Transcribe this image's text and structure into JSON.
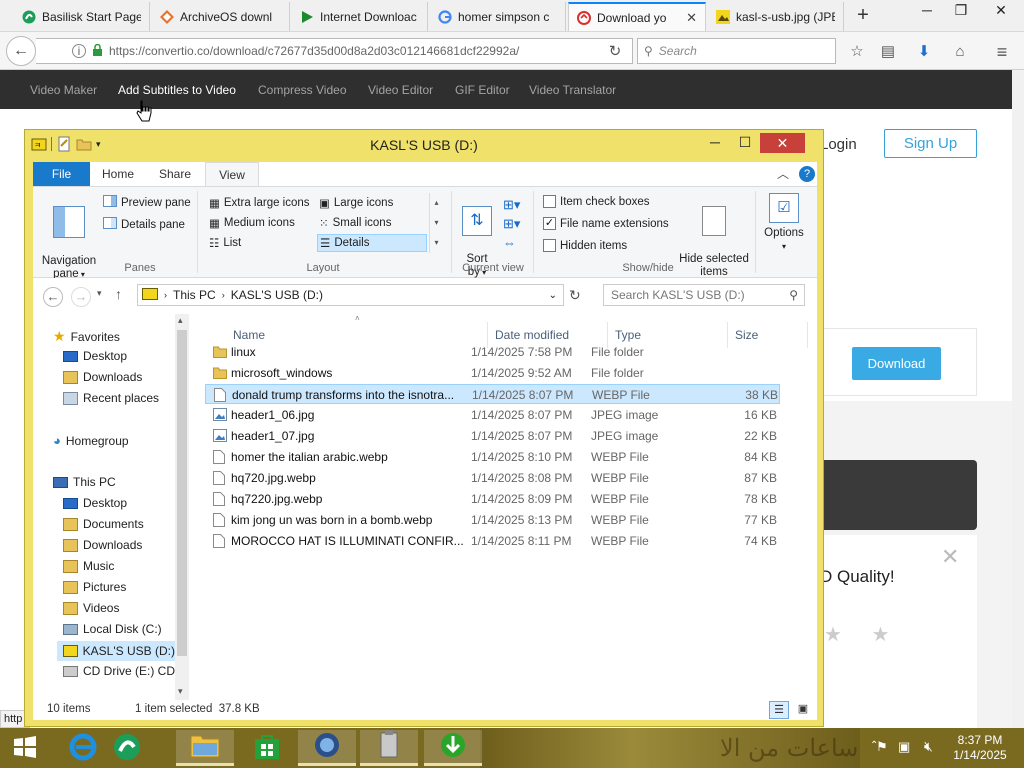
{
  "browser": {
    "tabs": [
      {
        "title": "Basilisk Start Page",
        "icon": "basilisk-icon"
      },
      {
        "title": "ArchiveOS downl",
        "icon": "archiveos-icon"
      },
      {
        "title": "Internet Downloac",
        "icon": "play-icon"
      },
      {
        "title": "homer simpson c",
        "icon": "google-icon"
      },
      {
        "title": "Download yo",
        "icon": "convertio-icon",
        "active": true
      },
      {
        "title": "kasl-s-usb.jpg (JPE",
        "icon": "image-icon"
      }
    ],
    "url": "https://convertio.co/download/c72677d35d00d8a2d03c012146681dcf22992a/",
    "search_placeholder": "Search"
  },
  "site": {
    "nav": [
      "Video Maker",
      "Add Subtitles to Video",
      "Compress Video",
      "Video Editor",
      "GIF Editor",
      "Video Translator"
    ],
    "nav_hovered": "Add Subtitles to Video",
    "login": "Login",
    "signup": "Sign Up",
    "download": "Download",
    "promo_text": "D Quality!",
    "promo_stars": "★ ★",
    "status_url": "http"
  },
  "explorer": {
    "title": "KASL'S USB (D:)",
    "ribbon_tabs": {
      "file": "File",
      "home": "Home",
      "share": "Share",
      "view": "View"
    },
    "ribbon": {
      "navigation_pane": "Navigation\npane",
      "preview_pane": "Preview pane",
      "details_pane": "Details pane",
      "panes_label": "Panes",
      "extra_large_icons": "Extra large icons",
      "large_icons": "Large icons",
      "medium_icons": "Medium icons",
      "small_icons": "Small icons",
      "list": "List",
      "details": "Details",
      "layout_label": "Layout",
      "sort_by": "Sort\nby",
      "current_view_label": "Current view",
      "item_check_boxes": "Item check boxes",
      "file_name_extensions": "File name extensions",
      "hidden_items": "Hidden items",
      "hide_selected_items": "Hide selected\nitems",
      "show_hide_label": "Show/hide",
      "options": "Options",
      "checked": {
        "item_check_boxes": false,
        "file_name_extensions": true,
        "hidden_items": false
      }
    },
    "breadcrumb": [
      "This PC",
      "KASL'S USB (D:)"
    ],
    "search_placeholder": "Search KASL'S USB (D:)",
    "nav_pane": {
      "favorites": "Favorites",
      "fav_items": [
        "Desktop",
        "Downloads",
        "Recent places"
      ],
      "homegroup": "Homegroup",
      "this_pc": "This PC",
      "pc_items": [
        "Desktop",
        "Documents",
        "Downloads",
        "Music",
        "Pictures",
        "Videos",
        "Local Disk (C:)",
        "KASL'S USB (D:)",
        "CD Drive (E:) CDF"
      ]
    },
    "columns": {
      "name": "Name",
      "date": "Date modified",
      "type": "Type",
      "size": "Size"
    },
    "files": [
      {
        "name": "linux",
        "date": "1/14/2025 7:58 PM",
        "type": "File folder",
        "size": "",
        "icon": "folder-icon"
      },
      {
        "name": "microsoft_windows",
        "date": "1/14/2025 9:52 AM",
        "type": "File folder",
        "size": "",
        "icon": "folder-icon"
      },
      {
        "name": "donald trump transforms into the isnotra...",
        "date": "1/14/2025 8:07 PM",
        "type": "WEBP File",
        "size": "38 KB",
        "icon": "file-icon",
        "selected": true
      },
      {
        "name": "header1_06.jpg",
        "date": "1/14/2025 8:07 PM",
        "type": "JPEG image",
        "size": "16 KB",
        "icon": "image-file-icon"
      },
      {
        "name": "header1_07.jpg",
        "date": "1/14/2025 8:07 PM",
        "type": "JPEG image",
        "size": "22 KB",
        "icon": "image-file-icon"
      },
      {
        "name": "homer the italian arabic.webp",
        "date": "1/14/2025 8:10 PM",
        "type": "WEBP File",
        "size": "84 KB",
        "icon": "file-icon"
      },
      {
        "name": "hq720.jpg.webp",
        "date": "1/14/2025 8:08 PM",
        "type": "WEBP File",
        "size": "87 KB",
        "icon": "file-icon"
      },
      {
        "name": "hq7220.jpg.webp",
        "date": "1/14/2025 8:09 PM",
        "type": "WEBP File",
        "size": "78 KB",
        "icon": "file-icon"
      },
      {
        "name": "kim jong un was born in a bomb.webp",
        "date": "1/14/2025 8:13 PM",
        "type": "WEBP File",
        "size": "77 KB",
        "icon": "file-icon"
      },
      {
        "name": "MOROCCO HAT IS ILLUMINATI CONFIR...",
        "date": "1/14/2025 8:11 PM",
        "type": "WEBP File",
        "size": "74 KB",
        "icon": "file-icon"
      }
    ],
    "status": {
      "count": "10 items",
      "selection": "1 item selected  37.8 KB"
    }
  },
  "taskbar": {
    "time": "8:37 PM",
    "date": "1/14/2025",
    "wallpaper_text": "ساعات من الا"
  },
  "colors": {
    "accent_blue": "#1979ca",
    "explorer_frame": "#f0e16a",
    "selection": "#cce8ff",
    "close_red": "#c7403a",
    "site_nav_bg": "#2f2f2f",
    "site_button": "#39aae3"
  }
}
